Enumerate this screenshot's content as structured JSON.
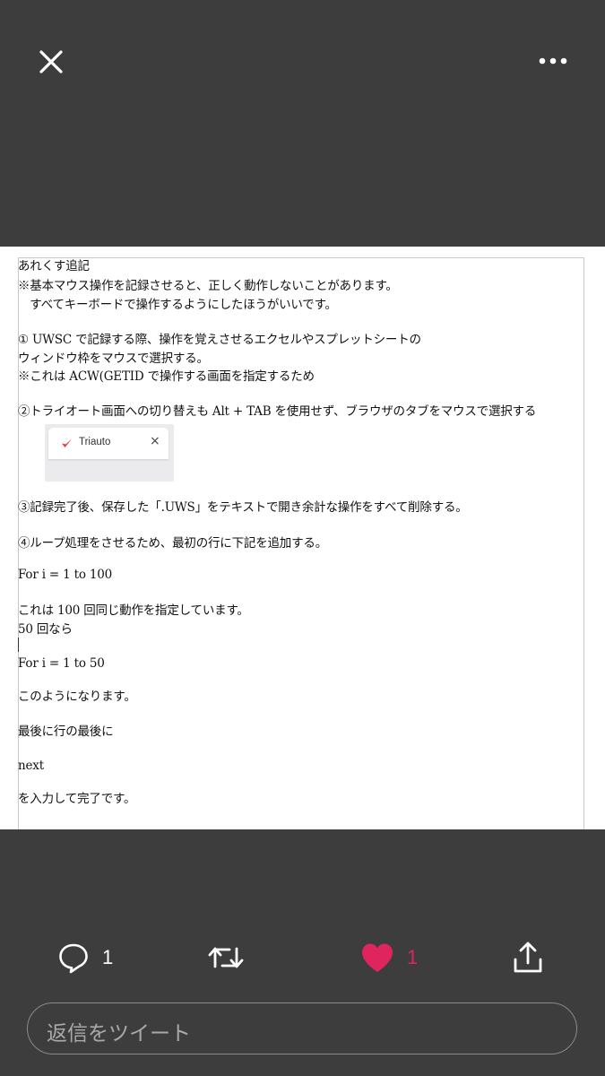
{
  "topbar": {
    "close_icon": "close-icon",
    "more_icon": "more-horizontal-icon"
  },
  "document": {
    "lines": [
      "あれくす追記",
      "※基本マウス操作を記録させると、正しく動作しないことがあります。",
      "　すべてキーボードで操作するようにしたほうがいいです。",
      "① UWSC で記録する際、操作を覚えさせるエクセルやスプレットシートの",
      "ウィンドウ枠をマウスで選択する。",
      "※これは ACW(GETID で操作する画面を指定するため",
      "②トライオート画面への切り替えも Alt + TAB を使用せず、ブラウザのタブをマウスで選択する",
      "③記録完了後、保存した「.UWS」をテキストで開き余計な操作をすべて削除する。",
      "④ループ処理をさせるため、最初の行に下記を追加する。",
      "For i = 1 to 100",
      "これは 100 回同じ動作を指定しています。",
      "50 回なら",
      "For i = 1 to 50",
      "このようになります。",
      "最後に行の最後に",
      "next",
      "を入力して完了です。"
    ],
    "browser_tab": {
      "title": "Triauto",
      "close": "×",
      "icon": "triauto-logo-icon",
      "icon_color": "#e53935"
    }
  },
  "actions": {
    "reply_count": "1",
    "like_count": "1",
    "like_color": "#e0245e"
  },
  "reply_box": {
    "placeholder": "返信をツイート"
  }
}
